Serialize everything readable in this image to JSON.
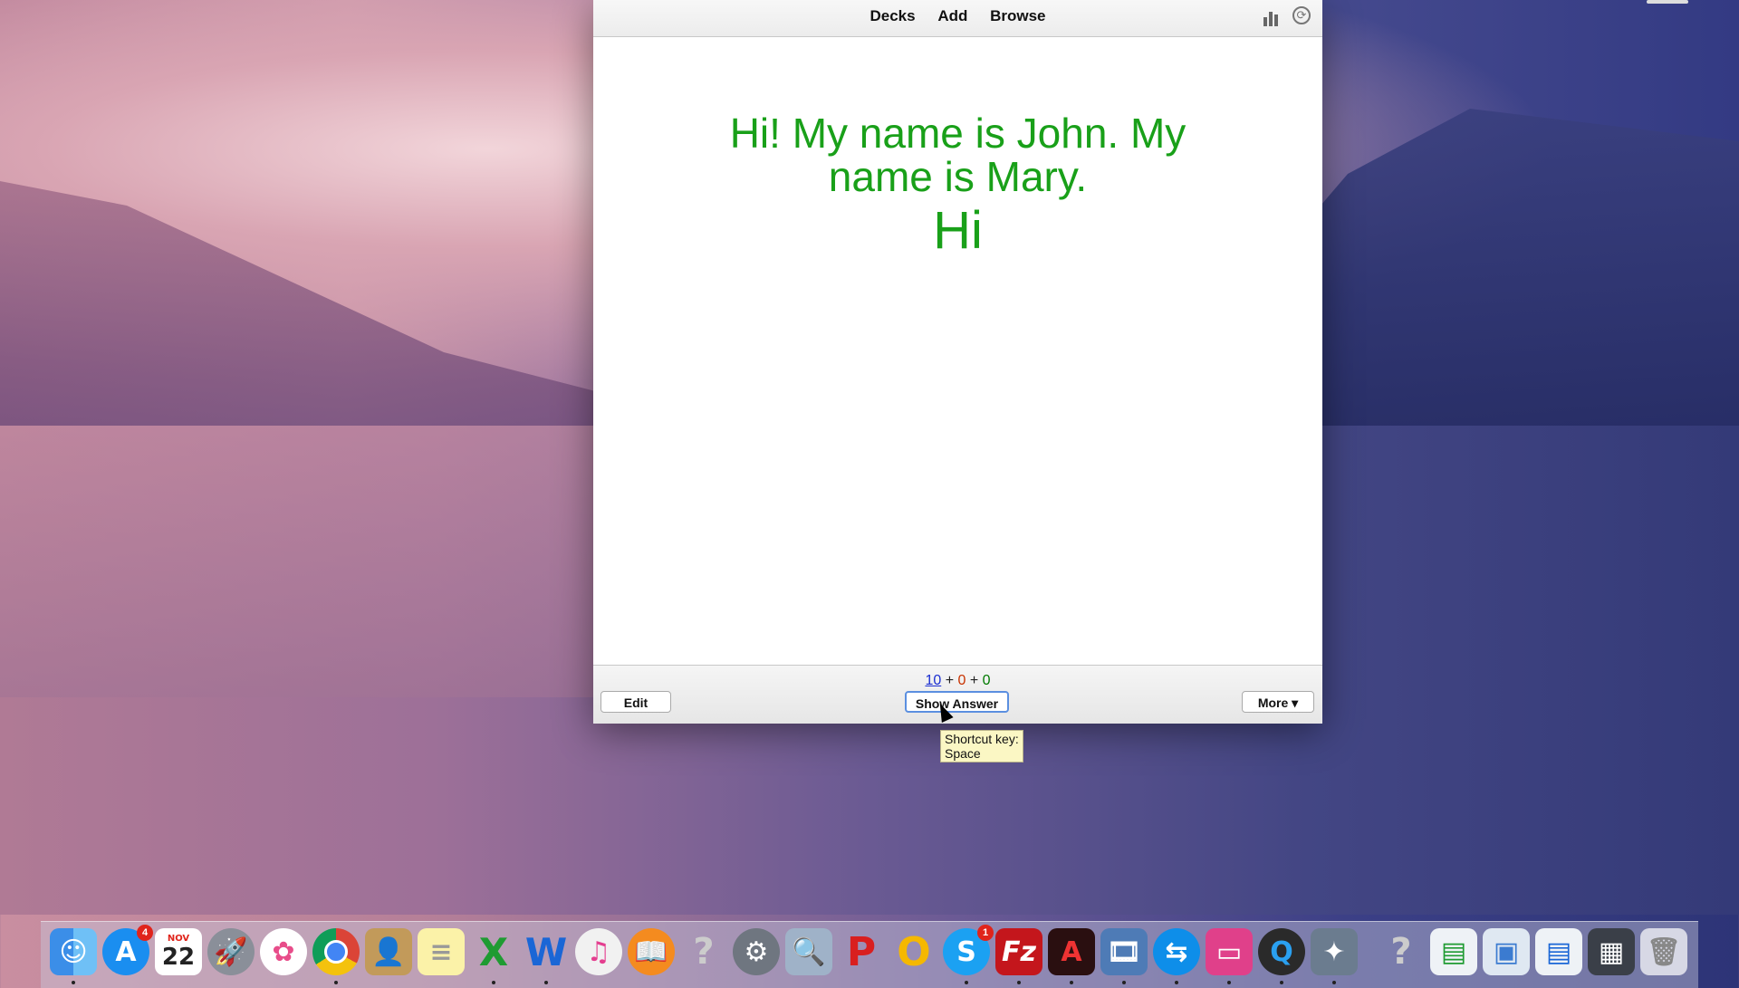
{
  "toolbar": {
    "decks": "Decks",
    "add": "Add",
    "browse": "Browse"
  },
  "card": {
    "question": "Hi! My name is John. My name is Mary.",
    "answer": "Hi"
  },
  "counts": {
    "new": "10",
    "plus1": "+",
    "learning": "0",
    "plus2": "+",
    "review": "0"
  },
  "buttons": {
    "edit": "Edit",
    "show_answer": "Show Answer",
    "more": "More ▾"
  },
  "tooltip": {
    "line1": "Shortcut key:",
    "line2": "Space"
  },
  "colors": {
    "card_text": "#19a019",
    "new_count": "#1b2fd1",
    "learn_count": "#c83200",
    "review_count": "#007a00"
  },
  "dock": {
    "calendar_month": "NOV",
    "calendar_day": "22",
    "appstore_badge": "4",
    "skype_badge": "1",
    "icons": [
      "finder-icon",
      "app-store-icon",
      "calendar-icon",
      "launchpad-icon",
      "photos-icon",
      "chrome-icon",
      "contacts-icon",
      "notes-icon",
      "excel-icon",
      "word-icon",
      "itunes-icon",
      "ibooks-icon",
      "unknown-app-icon",
      "system-preferences-icon",
      "preview-icon",
      "powerpoint-like-icon",
      "opera-icon",
      "skype-icon",
      "filezilla-icon",
      "acrobat-icon",
      "photo-theater-icon",
      "teamviewer-icon",
      "monitor-icon",
      "quicktime-icon",
      "xcode-like-icon",
      "unknown-app-icon",
      "excel-document-icon",
      "finder-window-icon",
      "word-document-icon",
      "screenshot-icon",
      "trash-icon"
    ]
  }
}
